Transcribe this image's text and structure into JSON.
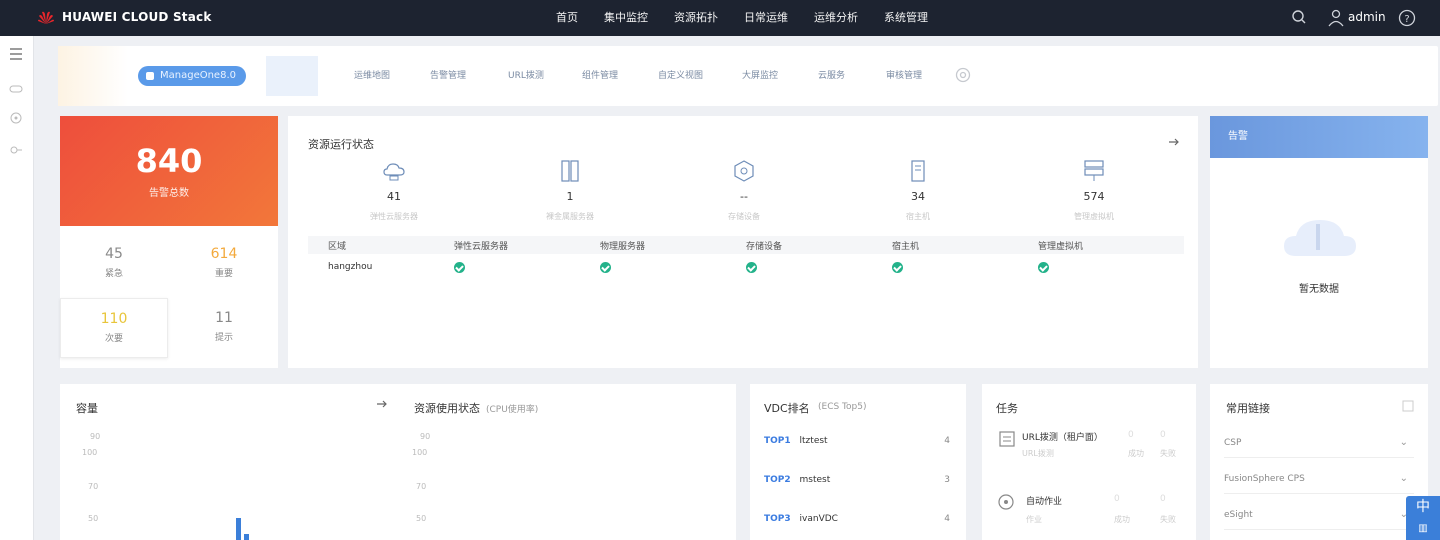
{
  "header": {
    "brand": "HUAWEI CLOUD Stack",
    "nav": [
      "首页",
      "集中监控",
      "资源拓扑",
      "日常运维",
      "运维分析",
      "系统管理"
    ],
    "user": "admin"
  },
  "tabs": {
    "chip": "ManageOne8.0",
    "items": [
      "运维地图",
      "告警管理",
      "URL拨测",
      "组件管理",
      "自定义视图",
      "大屏监控",
      "云服务",
      "审核管理"
    ]
  },
  "summary": {
    "total": "840",
    "total_label": "告警总数",
    "stats": [
      {
        "value": "45",
        "label": "紧急",
        "color": "#8a8a8a"
      },
      {
        "value": "614",
        "label": "重要",
        "color": "#f3a93c"
      },
      {
        "value": "110",
        "label": "次要",
        "color": "#e8c53a"
      },
      {
        "value": "11",
        "label": "提示",
        "color": "#888888"
      }
    ]
  },
  "resources": {
    "title": "资源运行状态",
    "items": [
      {
        "icon": "cloud-server-icon",
        "value": "41",
        "label": "弹性云服务器"
      },
      {
        "icon": "bare-metal-icon",
        "value": "1",
        "label": "裸金属服务器"
      },
      {
        "icon": "storage-icon",
        "value": "--",
        "label": "存储设备"
      },
      {
        "icon": "host-icon",
        "value": "34",
        "label": "宿主机"
      },
      {
        "icon": "management-vm-icon",
        "value": "574",
        "label": "管理虚拟机"
      }
    ],
    "table_headers": [
      "区域",
      "弹性云服务器",
      "物理服务器",
      "存储设备",
      "宿主机",
      "管理虚拟机"
    ],
    "row": {
      "region": "hangzhou"
    }
  },
  "alarm_panel": {
    "title": "告警",
    "empty": "暂无数据"
  },
  "capacity": {
    "title": "容量",
    "ticks": [
      "90",
      "100",
      "70",
      "50"
    ]
  },
  "usage": {
    "title": "资源使用状态",
    "subtitle": "(CPU使用率)",
    "ticks": [
      "90",
      "100",
      "70",
      "50"
    ]
  },
  "vdc": {
    "title": "VDC排名",
    "subtitle": "(ECS Top5)",
    "items": [
      {
        "rank": "TOP1",
        "name": "ltztest",
        "count": "4"
      },
      {
        "rank": "TOP2",
        "name": "mstest",
        "count": "3"
      },
      {
        "rank": "TOP3",
        "name": "ivanVDC",
        "count": "4"
      }
    ]
  },
  "tasks": {
    "title": "任务",
    "items": [
      {
        "name": "URL拨测（租户面）",
        "sub": "URL拨测",
        "a": "0",
        "b": "0",
        "a_lbl": "成功",
        "b_lbl": "失败"
      },
      {
        "name": "自动作业",
        "sub": "作业",
        "a": "0",
        "b": "0",
        "a_lbl": "成功",
        "b_lbl": "失败"
      }
    ]
  },
  "links": {
    "title": "常用链接",
    "items": [
      "CSP",
      "FusionSphere CPS",
      "eSight"
    ]
  },
  "corner": "中"
}
